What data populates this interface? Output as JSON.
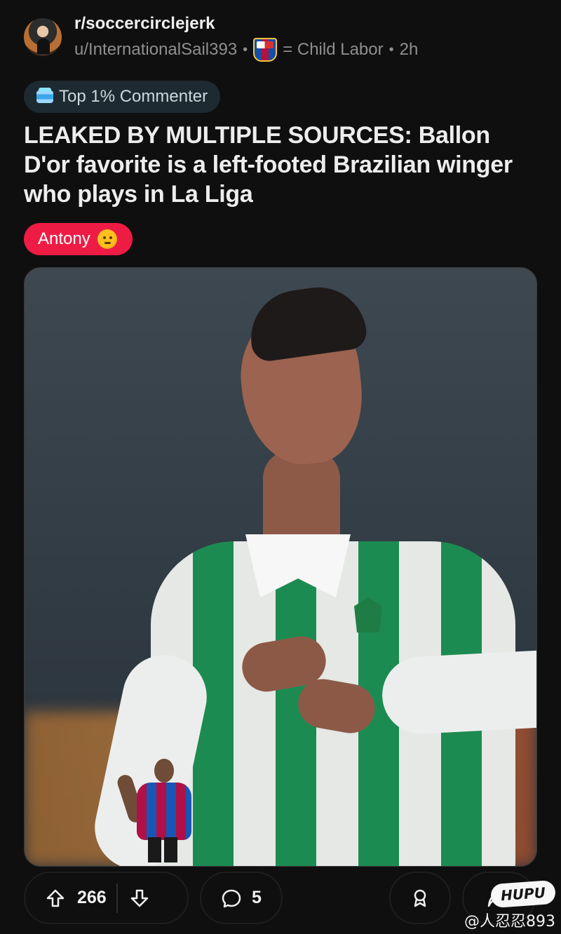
{
  "header": {
    "subreddit": "r/soccercirclejerk",
    "username": "u/InternationalSail393",
    "user_flair_text": "= Child Labor",
    "time": "2h",
    "avatar_icon": "avatar-icon",
    "user_flair_icon": "barcelona-crest-icon"
  },
  "badge": {
    "label": "Top 1% Commenter",
    "icon": "top-commenter-icon"
  },
  "post": {
    "title": "LEAKED BY MULTIPLE SOURCES: Ballon D'or favorite is a left-footed Brazilian winger who plays in La Liga",
    "flair": "Antony",
    "flair_emoji": "thinking-face-emoji"
  },
  "image": {
    "description_icon": "player-photo"
  },
  "actions": {
    "upvotes": "266",
    "comments": "5",
    "upvote_icon": "upvote-icon",
    "downvote_icon": "downvote-icon",
    "comment_icon": "comment-icon",
    "award_icon": "award-icon",
    "share_icon": "share-icon"
  },
  "watermark": {
    "logo_text": "HUPU",
    "text": "@人忍忍893"
  },
  "colors": {
    "background": "#0f0f0f",
    "badge_bg": "#1e2a31",
    "post_flair_bg": "#ee1c45",
    "muted_text": "#8f8f8f",
    "title_text": "#ededed"
  }
}
